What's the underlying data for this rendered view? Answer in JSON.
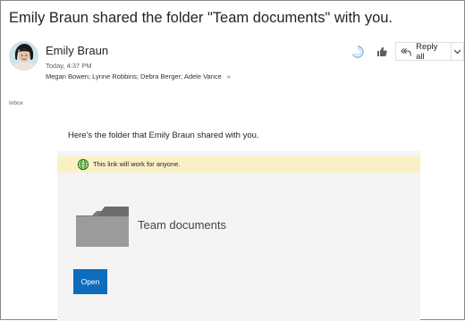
{
  "message": {
    "subject": "Emily Braun shared the folder \"Team documents\" with you.",
    "sender_name": "Emily Braun",
    "date": "Today, 4:37 PM",
    "recipients": "Megan Bowen; Lynne Robbins; Debra Berger; Adele Vance",
    "folder_label": "Inbox"
  },
  "actions": {
    "like_animation_icon": "sparkle-icon",
    "like_icon": "thumbs-up-icon",
    "reply_all_label": "Reply all",
    "reply_icon": "reply-all-icon",
    "more_icon": "chevron-down-icon"
  },
  "body": {
    "intro": "Here's the folder that Emily Braun shared with you.",
    "notice": "This link will work for anyone.",
    "shared_folder_name": "Team documents",
    "open_label": "Open"
  },
  "colors": {
    "accent": "#0f6cbd",
    "notice_bg": "#fbf0c5",
    "card_bg": "#f4f4f4",
    "globe": "#107c10"
  }
}
